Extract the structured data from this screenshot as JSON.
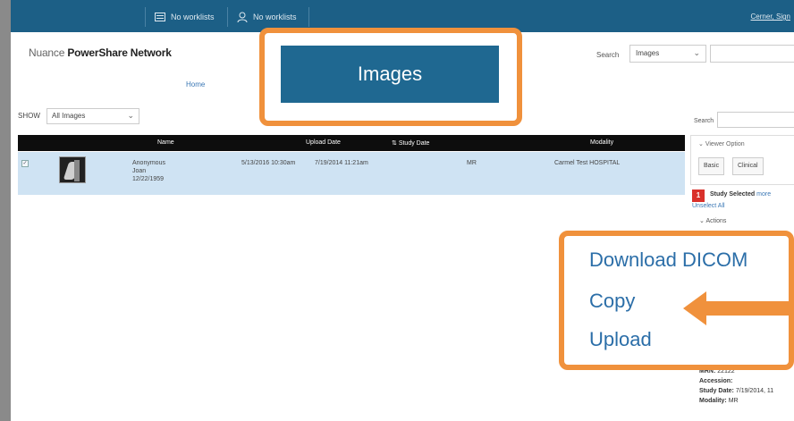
{
  "nav": {
    "tabs": [
      {
        "label": "No worklists",
        "icon": "list-icon"
      },
      {
        "label": "No worklists",
        "icon": "user-icon"
      }
    ],
    "user_link": "Cerner, Sign"
  },
  "brand": {
    "prefix": "Nuance",
    "name": "PowerShare Network"
  },
  "search": {
    "label": "Search",
    "value": "Images"
  },
  "breadcrumb": {
    "home": "Home"
  },
  "filter": {
    "label": "SHOW",
    "value": "All Images"
  },
  "table": {
    "columns": [
      "Name",
      "Upload Date",
      "Study Date",
      "Modality"
    ],
    "rows": [
      {
        "name_lines": [
          "Anonymous",
          "Joan",
          "12/22/1959"
        ],
        "upload_date": "5/13/2016 10:30am",
        "study_date": "7/19/2014 11:21am",
        "modality": "MR",
        "facility": "Carmel Test HOSPITAL"
      }
    ]
  },
  "sidebar": {
    "search_label": "Search",
    "viewer_options_title": "Viewer Option",
    "viewer_buttons": [
      "Basic",
      "Clinical"
    ],
    "selected_count": "1",
    "selected_label": "Study Selected",
    "selected_more": "more",
    "unselect_label": "Unselect All",
    "actions_label": "Actions",
    "details": {
      "mrn_label": "MRN:",
      "mrn_value": "22122",
      "accession_label": "Accession:",
      "study_date_label": "Study Date:",
      "study_date_value": "7/19/2014, 11",
      "modality_label": "Modality:",
      "modality_value": "MR"
    }
  },
  "callouts": {
    "images_title": "Images",
    "actions": [
      "Download DICOM",
      "Copy",
      "Upload"
    ],
    "accent_color": "#f0913c"
  }
}
